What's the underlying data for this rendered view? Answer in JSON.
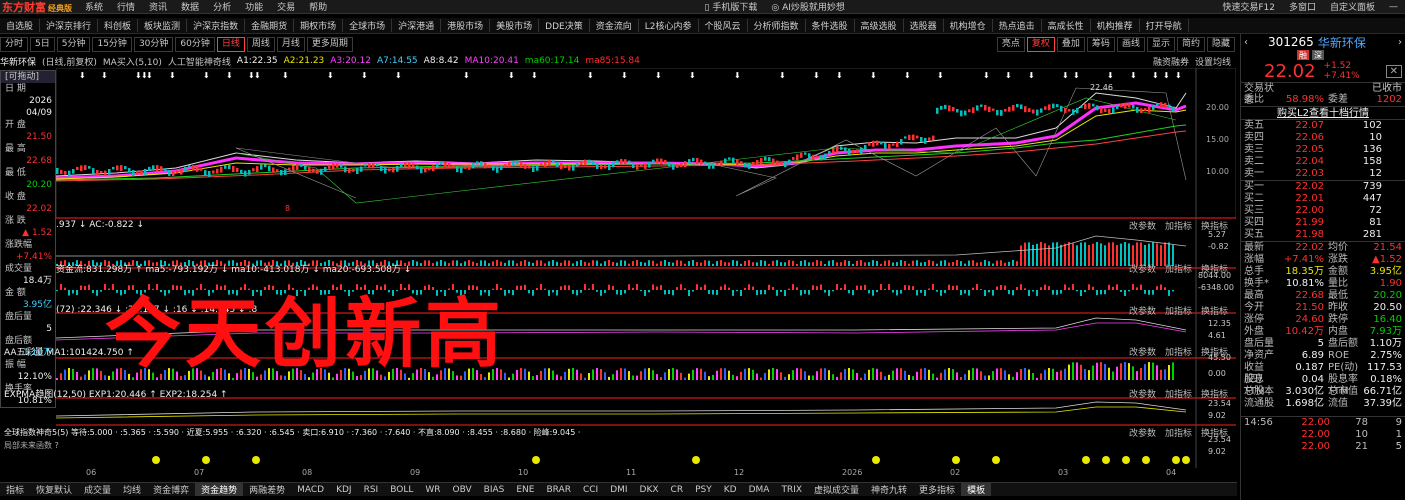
{
  "menubar": {
    "logo": "东方财富",
    "edition": "经典版",
    "items": [
      "系统",
      "行情",
      "资讯",
      "数据",
      "分析",
      "功能",
      "交易",
      "帮助"
    ],
    "center": [
      "手机版下载",
      "AI炒股就用妙想"
    ],
    "right": [
      "快速交易F12",
      "多窗口",
      "自定义面板"
    ]
  },
  "navbar": [
    "自选股",
    "沪深京排行",
    "科创板",
    "板块监测",
    "沪深京指数",
    "金融期货",
    "期权市场",
    "全球市场",
    "沪深港通",
    "港股市场",
    "美股市场",
    "DDE决策",
    "资金流向",
    "L2核心内参",
    "个股风云",
    "分析师指数",
    "条件选股",
    "高级选股",
    "选股器",
    "机构增仓",
    "热点追击",
    "高成长性",
    "机构推荐",
    "打开导航"
  ],
  "toolbar": {
    "left": [
      "分时",
      "5日",
      "5分钟",
      "15分钟",
      "30分钟",
      "60分钟",
      "日线",
      "周线",
      "月线",
      "更多周期"
    ],
    "active": "日线",
    "right": [
      "亮点",
      "复权",
      "叠加",
      "筹码",
      "画线",
      "显示",
      "简约",
      "隐藏"
    ]
  },
  "infobar": {
    "name": "华新环保",
    "mode": "(日线,前复权)",
    "ma_label": "MA买入(5,10)",
    "ai": "人工智能神奇线",
    "A1": "A1:22.35",
    "A2": "A2:21.23",
    "A3": "A3:20.12",
    "A7": "A7:14.55",
    "A8": "A8:8.42",
    "MA10": "MA10:20.41",
    "ma60": "ma60:17.14",
    "ma85": "ma85:15.84",
    "tags": [
      "融资融券",
      "设置均线"
    ]
  },
  "leftpanel": {
    "title": "[可拖动]",
    "rows": [
      {
        "k": "日 期",
        "v": "2026",
        "c": "white"
      },
      {
        "k": "",
        "v": "04/09",
        "c": "white"
      },
      {
        "k": "开 盘",
        "v": "21.50",
        "c": "red"
      },
      {
        "k": "最 高",
        "v": "22.68",
        "c": "red"
      },
      {
        "k": "最 低",
        "v": "20.20",
        "c": "green"
      },
      {
        "k": "收 盘",
        "v": "22.02",
        "c": "red"
      },
      {
        "k": "涨 跌",
        "v": "▲ 1.52",
        "c": "red"
      },
      {
        "k": "涨跌幅",
        "v": "+7.41%",
        "c": "red"
      },
      {
        "k": "成交量",
        "v": "18.4万",
        "c": "white"
      },
      {
        "k": "金 额",
        "v": "3.95亿",
        "c": "cyan"
      },
      {
        "k": "盘后量",
        "v": "5",
        "c": "white"
      },
      {
        "k": "盘后额",
        "v": "1.10万",
        "c": "cyan"
      },
      {
        "k": "振 幅",
        "v": "12.10%",
        "c": "white"
      },
      {
        "k": "换手率",
        "v": "10.81%",
        "c": "white"
      }
    ]
  },
  "price_axis": [
    "20.00",
    "15.00",
    "10.00"
  ],
  "annotations": {
    "high": "22.46",
    "low_marker": "8"
  },
  "panels": [
    {
      "title": ".937 ↓ AC:-0.822 ↓",
      "axis": [
        "5.27",
        "-0.82"
      ]
    },
    {
      "title": "资金流:831.298万 ↑ ma5:-793.192万 ↓ ma10:-413.018万 ↓ ma20:-693.508万 ↓",
      "axis": [
        "8044.00",
        "-6348.00"
      ]
    },
    {
      "title": "(72) :22.346 ↓ :20.117 ↓ :16 ↓ :14.545 ↓ :8",
      "axis": [
        "12.35",
        "4.61"
      ]
    },
    {
      "title": "AA五彩量 MA1:101424.750 ↑",
      "axis": [
        "45.50",
        "0.00"
      ]
    },
    {
      "title": "EXPMA趋图(12,50) EXP1:20.446 ↑ EXP2:18.254 ↑",
      "axis": [
        "23.54",
        "9.02"
      ]
    },
    {
      "title": "全球指数神奇5(5) 等待:5.000 · :5.365 · :5.590 · 近夏:5.955 · :6.320 · :6.545 · 卖口:6.910 · :7.360 · :7.640 · 不直:8.090 · :8.455 · :8.680 · 险峰:9.045 ·",
      "axis": [
        "23.54",
        "9.02"
      ],
      "note": "局部未来函数 ?"
    }
  ],
  "panel_tools": [
    "改参数",
    "加指标",
    "换指标"
  ],
  "xaxis": [
    "06",
    "07",
    "08",
    "09",
    "10",
    "11",
    "12",
    "2026",
    "02",
    "03",
    "04"
  ],
  "overlay_text": "今天创新高",
  "bottombar": {
    "items": [
      "指标",
      "恢复默认",
      "成交量",
      "均线",
      "资金博弈",
      "资金趋势",
      "两融差势",
      "MACD",
      "KDJ",
      "RSI",
      "BOLL",
      "WR",
      "OBV",
      "BIAS",
      "ENE",
      "BRAR",
      "CCI",
      "DMI",
      "DKX",
      "CR",
      "PSY",
      "KD",
      "DMA",
      "TRIX",
      "虚拟成交量",
      "神奇九转",
      "更多指标",
      "模板"
    ],
    "active": "资金趋势"
  },
  "right_panel": {
    "code": "301265",
    "name": "华新环保",
    "tags": [
      "融",
      "深"
    ],
    "price": "22.02",
    "change": "+1.52",
    "pct": "+7.41%",
    "status_label": "交易状态",
    "status": "已收市",
    "weibi_label": "委比",
    "weibi": "58.98%",
    "weicha_label": "委差",
    "weicha": "1202",
    "l2": "购买L2查看十档行情",
    "asks": [
      {
        "lab": "卖五",
        "p": "22.07",
        "q": "102"
      },
      {
        "lab": "卖四",
        "p": "22.06",
        "q": "10"
      },
      {
        "lab": "卖三",
        "p": "22.05",
        "q": "136"
      },
      {
        "lab": "卖二",
        "p": "22.04",
        "q": "158"
      },
      {
        "lab": "卖一",
        "p": "22.03",
        "q": "12"
      }
    ],
    "bids": [
      {
        "lab": "买一",
        "p": "22.02",
        "q": "739"
      },
      {
        "lab": "买二",
        "p": "22.01",
        "q": "447"
      },
      {
        "lab": "买三",
        "p": "22.00",
        "q": "72"
      },
      {
        "lab": "买四",
        "p": "21.99",
        "q": "81"
      },
      {
        "lab": "买五",
        "p": "21.98",
        "q": "281"
      }
    ],
    "stats": [
      {
        "k": "最新",
        "v": "22.02",
        "c": "red",
        "k2": "均价",
        "v2": "21.54",
        "c2": "red"
      },
      {
        "k": "涨幅",
        "v": "+7.41%",
        "c": "red",
        "k2": "涨跌",
        "v2": "▲1.52",
        "c2": "red"
      },
      {
        "k": "总手",
        "v": "18.35万",
        "c": "yellow",
        "k2": "金额",
        "v2": "3.95亿",
        "c2": "yellow"
      },
      {
        "k": "换手*",
        "v": "10.81%",
        "c": "white",
        "k2": "量比",
        "v2": "1.90",
        "c2": "red"
      },
      {
        "k": "最高",
        "v": "22.68",
        "c": "red",
        "k2": "最低",
        "v2": "20.20",
        "c2": "green"
      },
      {
        "k": "今开",
        "v": "21.50",
        "c": "red",
        "k2": "昨收",
        "v2": "20.50",
        "c2": "white"
      },
      {
        "k": "涨停",
        "v": "24.60",
        "c": "red",
        "k2": "跌停",
        "v2": "16.40",
        "c2": "green"
      },
      {
        "k": "外盘",
        "v": "10.42万",
        "c": "red",
        "k2": "内盘",
        "v2": "7.93万",
        "c2": "green"
      },
      {
        "k": "盘后量",
        "v": "5",
        "c": "white",
        "k2": "盘后额",
        "v2": "1.10万",
        "c2": "white"
      },
      {
        "k": "净资产",
        "v": "6.89",
        "c": "white",
        "k2": "ROE",
        "v2": "2.75%",
        "c2": "white"
      },
      {
        "k": "收益(四)",
        "v": "0.187",
        "c": "white",
        "k2": "PE(动)",
        "v2": "117.53",
        "c2": "white"
      },
      {
        "k": "股息TTM",
        "v": "0.04",
        "c": "white",
        "k2": "股息率TTM",
        "v2": "0.18%",
        "c2": "white"
      },
      {
        "k": "总股本",
        "v": "3.030亿",
        "c": "white",
        "k2": "总市值",
        "v2": "66.71亿",
        "c2": "white"
      },
      {
        "k": "流通股",
        "v": "1.698亿",
        "c": "white",
        "k2": "流值",
        "v2": "37.39亿",
        "c2": "white"
      }
    ],
    "ticks": [
      {
        "t": "14:56",
        "p": "22.00",
        "q": "78",
        "n": "9"
      },
      {
        "t": "",
        "p": "22.00",
        "q": "10",
        "n": "1"
      },
      {
        "t": "",
        "p": "22.00",
        "q": "21",
        "n": "5"
      }
    ]
  }
}
